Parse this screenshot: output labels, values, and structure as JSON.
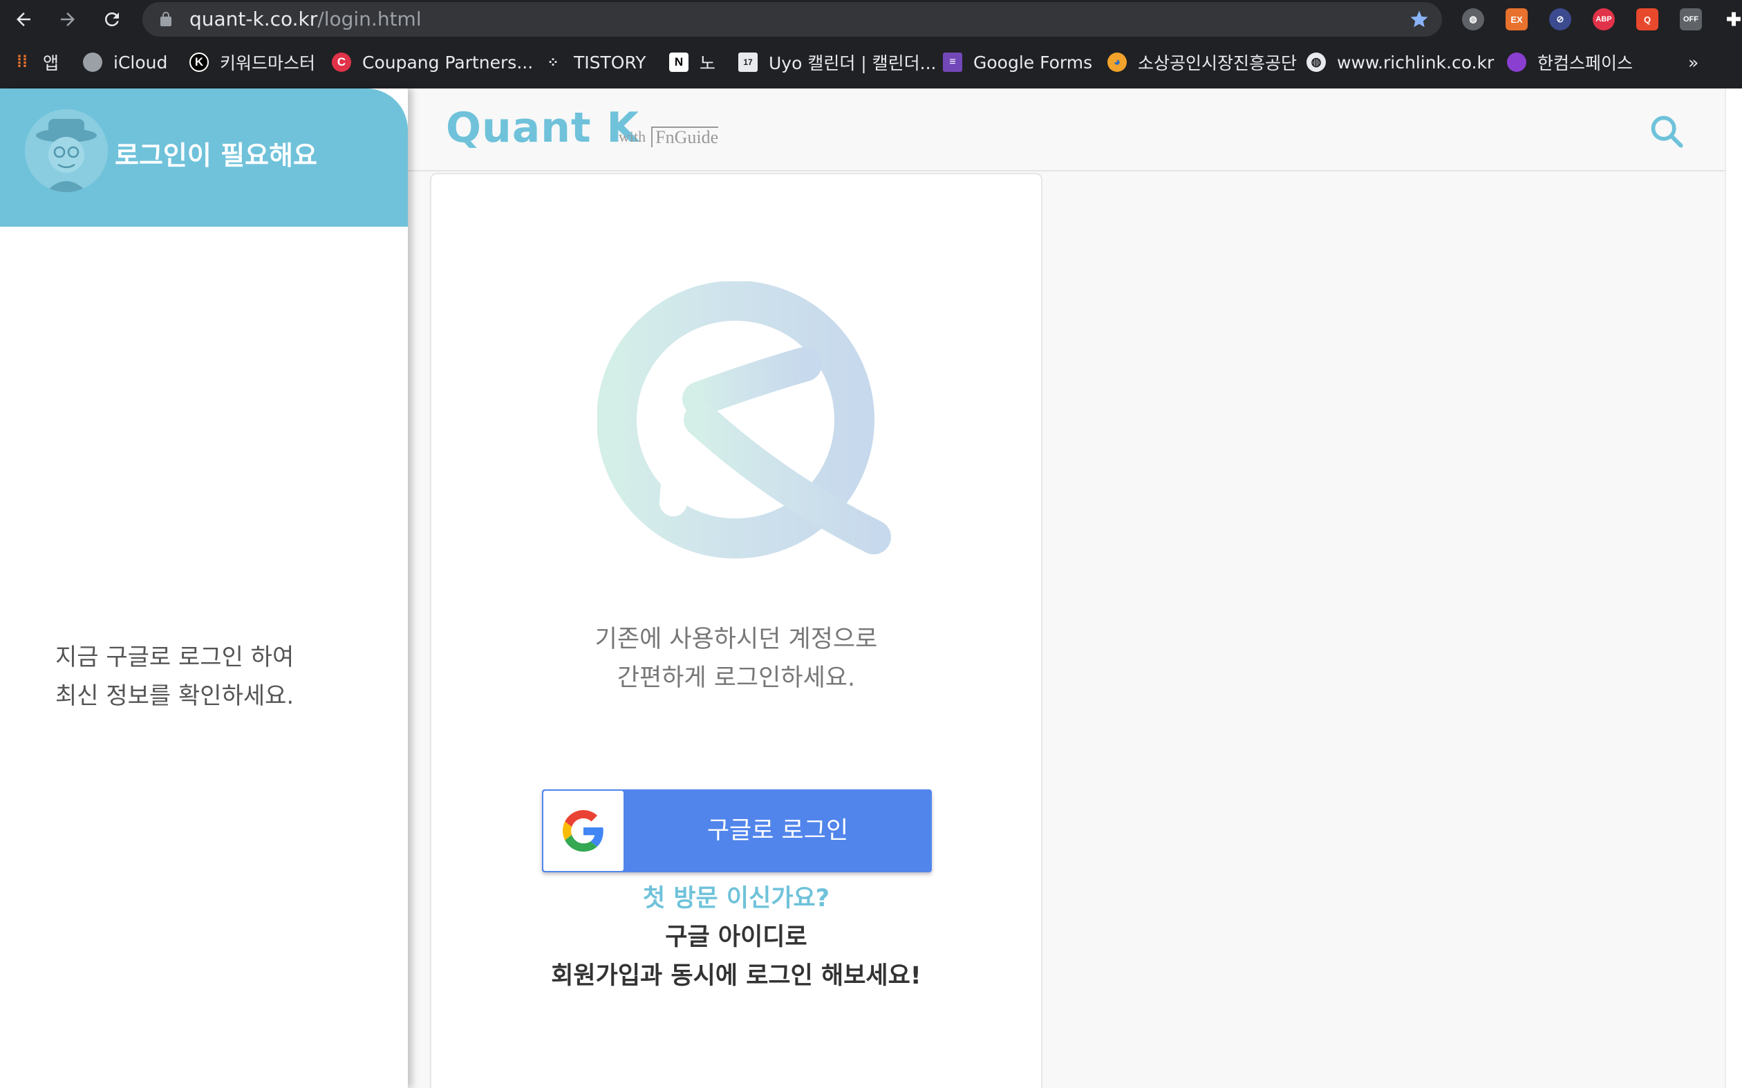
{
  "browser": {
    "url_host": "quant-k.co.kr",
    "url_path": "/login.html",
    "bookmarks": [
      {
        "label": "앱",
        "icon": "apps-grid-icon"
      },
      {
        "label": "iCloud",
        "icon": "apple-icon"
      },
      {
        "label": "키워드마스터",
        "icon": "k-logo-icon"
      },
      {
        "label": "Coupang Partners...",
        "icon": "coupang-icon"
      },
      {
        "label": "TISTORY",
        "icon": "tistory-icon"
      },
      {
        "label": "노",
        "icon": "notion-icon"
      },
      {
        "label": "Uyo 캘린더 | 캘린더...",
        "icon": "calendar-icon"
      },
      {
        "label": "Google Forms",
        "icon": "google-forms-icon"
      },
      {
        "label": "소상공인시장진흥공단",
        "icon": "semas-icon"
      },
      {
        "label": "www.richlink.co.kr",
        "icon": "globe-icon"
      },
      {
        "label": "한컴스페이스",
        "icon": "hancom-icon"
      }
    ],
    "bookmarks_overflow": "»",
    "extensions": [
      "globe-ext",
      "EX",
      "block-ext",
      "ABP",
      "search-ext",
      "OFF"
    ]
  },
  "sidebar": {
    "title": "로그인이 필요해요",
    "message_line1": "지금 구글로 로그인 하여",
    "message_line2": "최신 정보를 확인하세요."
  },
  "header": {
    "brand": "Quant K",
    "with": "with",
    "partner": "FnGuide"
  },
  "login": {
    "welcome_line1": "기존에 사용하시던 계정으로",
    "welcome_line2": "간편하게 로그인하세요.",
    "google_button": "구글로 로그인",
    "first_visit": "첫 방문 이신가요?",
    "signup_line1": "구글 아이디로",
    "signup_line2": "회원가입과 동시에 로그인 해보세요!"
  },
  "colors": {
    "accent": "#6fc2da",
    "google_blue": "#5185ec",
    "chrome_dark": "#202124"
  }
}
